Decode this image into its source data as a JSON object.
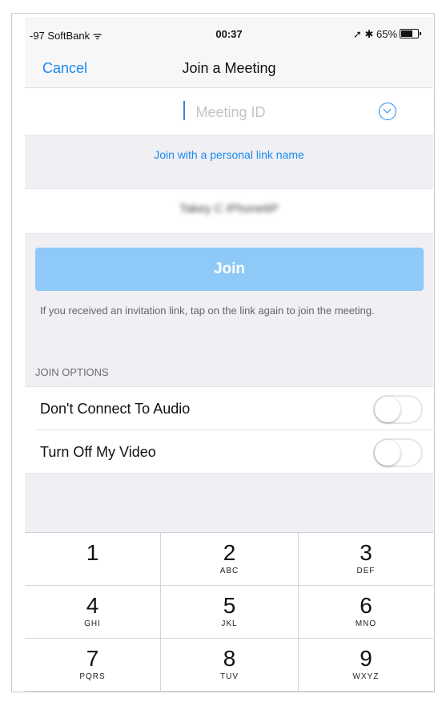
{
  "status_bar": {
    "carrier": "-97 SoftBank ᯤ",
    "time": "00:37",
    "battery": "➚ ✱ 65%"
  },
  "nav": {
    "cancel_label": "Cancel",
    "title": "Join a Meeting"
  },
  "meeting_id": {
    "placeholder": "Meeting ID",
    "value": "",
    "dropdown_icon": "chevron-down-circle-icon"
  },
  "personal_link_label": "Join with a personal link name",
  "display_name": "Takey C iPhone6P",
  "join_button_label": "Join",
  "hint_text": "If you received an invitation link, tap on the link again to join the meeting.",
  "join_options": {
    "header": "JOIN OPTIONS",
    "items": [
      {
        "label": "Don't Connect To Audio",
        "enabled": false
      },
      {
        "label": "Turn Off My Video",
        "enabled": false
      }
    ]
  },
  "keypad": [
    {
      "num": "1",
      "letters": ""
    },
    {
      "num": "2",
      "letters": "ABC"
    },
    {
      "num": "3",
      "letters": "DEF"
    },
    {
      "num": "4",
      "letters": "GHI"
    },
    {
      "num": "5",
      "letters": "JKL"
    },
    {
      "num": "6",
      "letters": "MNO"
    },
    {
      "num": "7",
      "letters": "PQRS"
    },
    {
      "num": "8",
      "letters": "TUV"
    },
    {
      "num": "9",
      "letters": "WXYZ"
    }
  ],
  "colors": {
    "accent": "#1a8cef",
    "join_button": "#8ec9f7",
    "background": "#efeff4"
  }
}
